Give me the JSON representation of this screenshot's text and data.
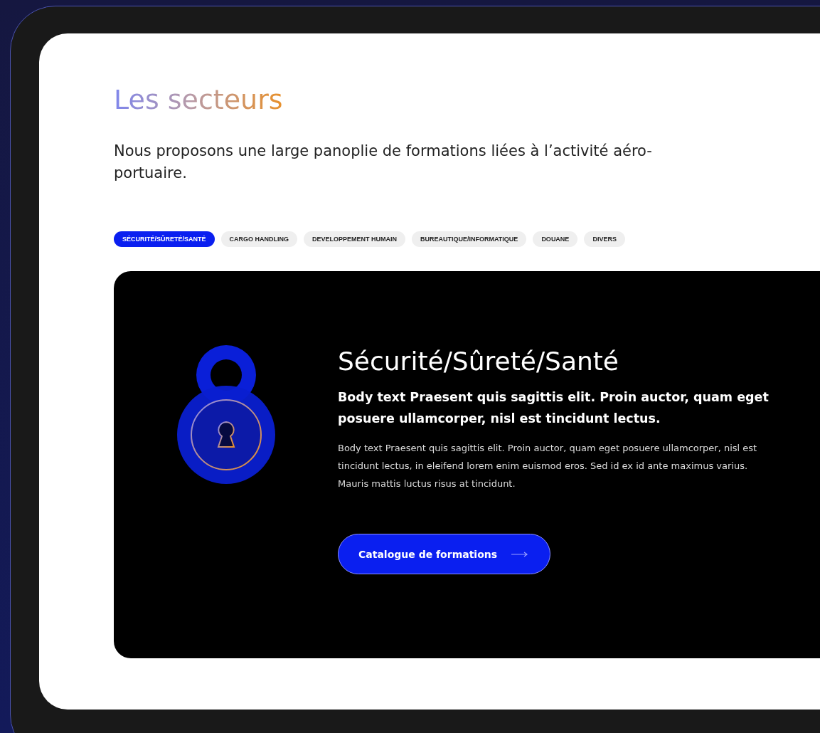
{
  "section": {
    "title": "Les secteurs",
    "intro": "Nous proposons une large panoplie de formations liées à l’activité aéro-portuaire."
  },
  "tabs": [
    {
      "label": "SÉCURITÉ/SÛRETÉ/SANTÉ",
      "selected": true
    },
    {
      "label": "CARGO HANDLING",
      "selected": false
    },
    {
      "label": "DEVELOPPEMENT HUMAIN",
      "selected": false
    },
    {
      "label": "BUREAUTIQUE/INFORMATIQUE",
      "selected": false
    },
    {
      "label": "DOUANE",
      "selected": false
    },
    {
      "label": "DIVERS",
      "selected": false
    }
  ],
  "card": {
    "heading": "Sécurité/Sûreté/Santé",
    "lead": "Body text Praesent quis sagittis elit. Proin auctor, quam eget posuere ullamcorper, nisl est tincidunt lectus.",
    "body": "Body text Praesent quis sagittis elit. Proin auctor, quam eget posuere ullamcorper, nisl est tincidunt lectus, in eleifend lorem enim euismod eros. Sed id ex id ante maximus varius. Mauris mattis luctus risus at tincidunt.",
    "button": "Catalogue de formations"
  }
}
